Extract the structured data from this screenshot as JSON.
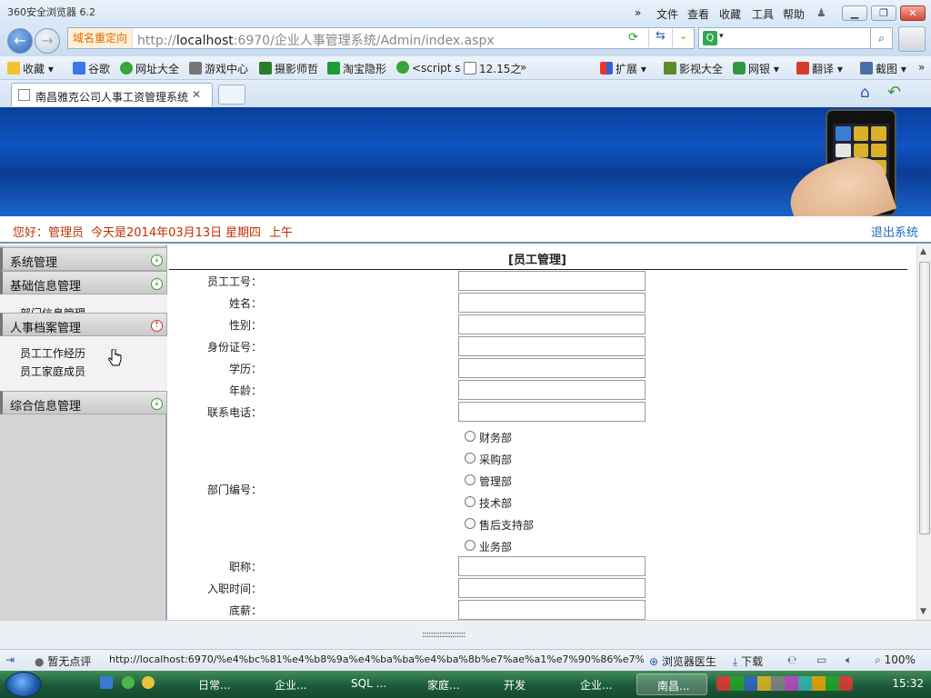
{
  "browser": {
    "app_title": "360安全浏览器 6.2",
    "menu": [
      "文件",
      "查看",
      "收藏",
      "工具",
      "帮助"
    ],
    "redirect_label": "域名重定向",
    "url_prefix": "http://",
    "url_host": "localhost",
    "url_rest": ":6970/企业人事管理系统/Admin/index.aspx",
    "bookmarks": [
      "收藏",
      "谷歌",
      "网址大全",
      "游戏中心",
      "摄影师哲",
      "淘宝隐形",
      "<script s",
      "12.15之"
    ],
    "bookmark_more": "»",
    "right_tools": [
      "扩展",
      "影视大全",
      "网银",
      "翻译",
      "截图"
    ],
    "tab_title": "南昌雅克公司人事工资管理系统",
    "tab_close": "✕"
  },
  "page": {
    "greeting": "您好：管理员",
    "date_text": "今天是2014年03月13日",
    "weekday": "星期四",
    "ampm": "上午",
    "logout": "退出系统",
    "sidebar": {
      "sections": [
        "系统管理",
        "基础信息管理",
        "人事档案管理",
        "综合信息管理"
      ],
      "basic_sub": "部门信息管理",
      "hr_sub": [
        "员工工作经历",
        "员工家庭成员"
      ]
    },
    "form": {
      "heading": "[员工管理]",
      "fields": [
        "员工工号：",
        "姓名：",
        "性别：",
        "身份证号：",
        "学历：",
        "年龄：",
        "联系电话："
      ],
      "dept_label": "部门编号：",
      "departments": [
        "财务部",
        "采购部",
        "管理部",
        "技术部",
        "售后支持部",
        "业务部"
      ],
      "fields_after": [
        "职称：",
        "入职时间：",
        "底薪："
      ]
    }
  },
  "status": {
    "no_comment": "暂无点评",
    "status_url": "http://localhost:6970/%e4%bc%81%e4%b8%9a%e4%ba%ba%e4%ba%8b%e7%ae%a1%e7%90%86%e7%b3%bb",
    "doctor": "浏览器医生",
    "download": "下载",
    "zoom": "100%",
    "splitter": "::::::::::::::::::::"
  },
  "taskbar": {
    "items": [
      "日常...",
      "企业...",
      "SQL ...",
      "家庭...",
      "开发",
      "企业...",
      "南昌..."
    ],
    "clock": "15:32"
  }
}
